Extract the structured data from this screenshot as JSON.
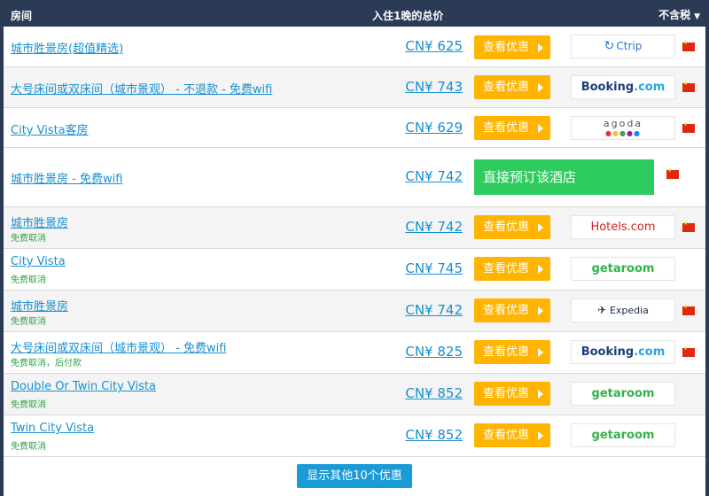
{
  "header": {
    "room_col": "房间",
    "price_col": "入住1晚的总价",
    "tax_toggle": "不含税"
  },
  "rows": [
    {
      "name": "城市胜景房(超值精选)",
      "sub": "",
      "price": "CN¥ 625",
      "button": "查看优惠",
      "provider": "Ctrip",
      "flag": true
    },
    {
      "name": "大号床间或双床间（城市景观） - 不退款 - 免费wifi",
      "sub": "",
      "price": "CN¥ 743",
      "button": "查看优惠",
      "provider": "Booking.com",
      "flag": true
    },
    {
      "name": "City Vista客房",
      "sub": "",
      "price": "CN¥ 629",
      "button": "查看优惠",
      "provider": "agoda",
      "flag": true
    },
    {
      "name": "城市胜景房 - 免费wifi",
      "sub": "",
      "price": "CN¥ 742",
      "button": "直接预订该酒店",
      "provider": "",
      "flag": true,
      "direct": true
    },
    {
      "name": "城市胜景房",
      "sub": "免费取消",
      "price": "CN¥ 742",
      "button": "查看优惠",
      "provider": "Hotels.com",
      "flag": true
    },
    {
      "name": "City Vista",
      "sub": "免费取消",
      "price": "CN¥ 745",
      "button": "查看优惠",
      "provider": "getaroom",
      "flag": false
    },
    {
      "name": "城市胜景房",
      "sub": "免费取消",
      "price": "CN¥ 742",
      "button": "查看优惠",
      "provider": "Expedia",
      "flag": true
    },
    {
      "name": "大号床间或双床间（城市景观） - 免费wifi",
      "sub": "免费取消，后付款",
      "price": "CN¥ 825",
      "button": "查看优惠",
      "provider": "Booking.com",
      "flag": true
    },
    {
      "name": "Double Or Twin City Vista",
      "sub": "免费取消",
      "price": "CN¥ 852",
      "button": "查看优惠",
      "provider": "getaroom",
      "flag": false
    },
    {
      "name": "Twin City Vista",
      "sub": "免费取消",
      "price": "CN¥ 852",
      "button": "查看优惠",
      "provider": "getaroom",
      "flag": false
    }
  ],
  "more_button": "显示其他10个优惠",
  "colors": {
    "header_bg": "#2b3a55",
    "link": "#1a8fd0",
    "deal_button": "#ffb400",
    "direct_button": "#2ecc5e",
    "more_button": "#1a9ad6",
    "free_cancel": "#35a049"
  }
}
